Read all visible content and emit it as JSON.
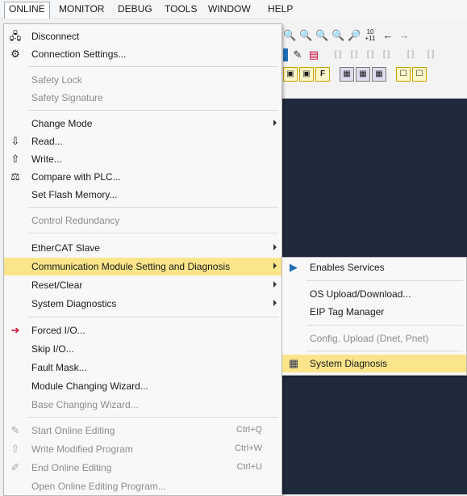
{
  "menubar": [
    "ONLINE",
    "MONITOR",
    "DEBUG",
    "TOOLS",
    "WINDOW",
    "HELP"
  ],
  "menu": {
    "disconnect": "Disconnect",
    "connection_settings": "Connection Settings...",
    "safety_lock": "Safety Lock",
    "safety_signature": "Safety Signature",
    "change_mode": "Change Mode",
    "read": "Read...",
    "write": "Write...",
    "compare": "Compare with PLC...",
    "set_flash": "Set Flash Memory...",
    "control_redundancy": "Control Redundancy",
    "ethercat_slave": "EtherCAT Slave",
    "comm_module": "Communication Module Setting and Diagnosis",
    "reset_clear": "Reset/Clear",
    "system_diagnostics": "System Diagnostics",
    "forced_io": "Forced I/O...",
    "skip_io": "Skip I/O...",
    "fault_mask": "Fault Mask...",
    "module_changing": "Module Changing Wizard...",
    "base_changing": "Base Changing Wizard...",
    "start_online_editing": "Start Online Editing",
    "start_online_editing_sc": "Ctrl+Q",
    "write_modified": "Write Modified Program",
    "write_modified_sc": "Ctrl+W",
    "end_online_editing": "End Online Editing",
    "end_online_editing_sc": "Ctrl+U",
    "open_online_editing": "Open Online Editing Program..."
  },
  "submenu": {
    "enables_services": "Enables Services",
    "os_upload": "OS Upload/Download...",
    "eip_tag": "EIP Tag Manager",
    "config_upload": "Config. Upload (Dnet, Pnet)",
    "system_diagnosis": "System Diagnosis"
  },
  "toolbar": {
    "shift_badge": "10\n+11"
  },
  "colors": {
    "highlight": "#fbe58a",
    "workspace": "#1f2a3c"
  }
}
